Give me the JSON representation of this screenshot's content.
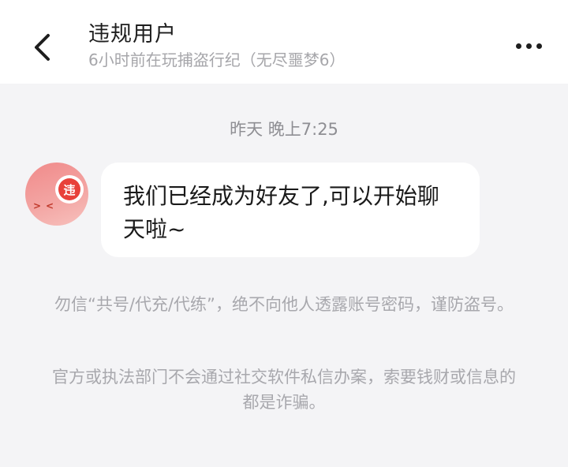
{
  "header": {
    "title": "违规用户",
    "subtitle": "6小时前在玩捕盗行纪（无尽噩梦6）",
    "back_icon": "chevron-left-icon",
    "more_icon": "more-horizontal-icon"
  },
  "chat": {
    "timestamp": "昨天 晚上7:25",
    "message": {
      "avatar_badge": "违",
      "avatar_face": "><",
      "text": "我们已经成为好友了,可以开始聊天啦~"
    }
  },
  "notices": [
    "勿信“共号/代充/代练”，绝不向他人透露账号密码，谨防盗号。",
    "官方或执法部门不会通过社交软件私信办案，索要钱财或信息的都是诈骗。"
  ],
  "colors": {
    "background": "#f4f4f6",
    "bubble": "#ffffff",
    "badge": "#e8413a",
    "notice_text": "#a8a8ad"
  }
}
